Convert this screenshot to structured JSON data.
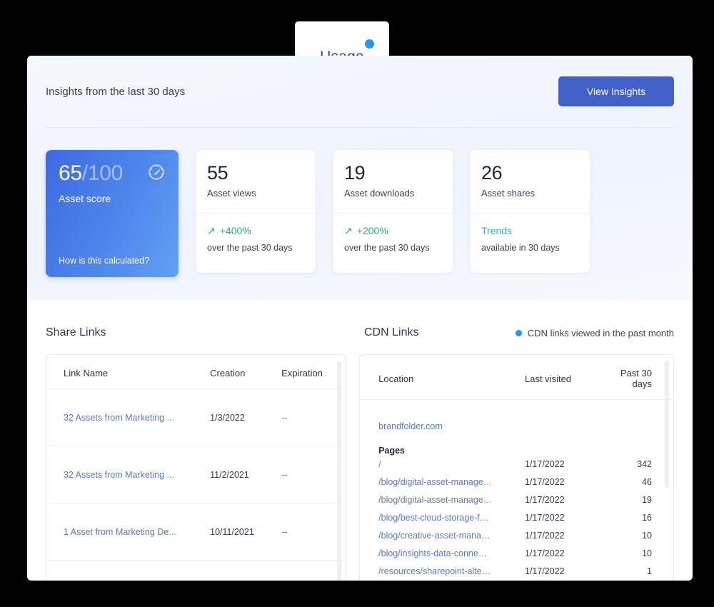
{
  "tab": {
    "label": "Usage",
    "dot_icon": "blue-dot-indicator",
    "dot_color": "#2196f3"
  },
  "header": {
    "title": "Insights from the last 30 days",
    "view_insights_label": "View Insights",
    "button_color": "#4160c8"
  },
  "score_card": {
    "value": "65",
    "denominator": "/100",
    "label": "Asset score",
    "footer_link": "How is this calculated?",
    "icon": "gauge-icon",
    "gradient_from": "#3f6ae0",
    "gradient_to": "#63a0f3"
  },
  "metrics": [
    {
      "number": "55",
      "label": "Asset views",
      "delta_icon": "arrow-up-right-icon",
      "delta": "+400%",
      "delta_color": "#22b07d",
      "sub": "over the past 30 days"
    },
    {
      "number": "19",
      "label": "Asset downloads",
      "delta_icon": "arrow-up-right-icon",
      "delta": "+200%",
      "delta_color": "#22b07d",
      "sub": "over the past 30 days"
    },
    {
      "number": "26",
      "label": "Asset shares",
      "delta_icon": "",
      "delta": "Trends",
      "delta_color": "#35aee0",
      "sub": "available in 30 days"
    }
  ],
  "share_links": {
    "title": "Share Links",
    "columns": [
      "Link Name",
      "Creation",
      "Expiration"
    ],
    "rows": [
      {
        "name": "32 Assets from Marketing ...",
        "creation": "1/3/2022",
        "expiration": "--"
      },
      {
        "name": "32 Assets from Marketing ...",
        "creation": "11/2/2021",
        "expiration": "--"
      },
      {
        "name": "1 Asset from Marketing De...",
        "creation": "10/11/2021",
        "expiration": "--"
      }
    ]
  },
  "cdn_links": {
    "title": "CDN Links",
    "legend": "CDN links viewed in the past month",
    "legend_dot_color": "#2196f3",
    "columns": [
      "Location",
      "Last visited",
      "Past 30 days"
    ],
    "domain": "brandfolder.com",
    "pages_label": "Pages",
    "rows": [
      {
        "path": "/",
        "last_visited": "1/17/2022",
        "past30": "342"
      },
      {
        "path": "/blog/digital-asset-manage…",
        "last_visited": "1/17/2022",
        "past30": "46"
      },
      {
        "path": "/blog/digital-asset-manage…",
        "last_visited": "1/17/2022",
        "past30": "19"
      },
      {
        "path": "/blog/best-cloud-storage-f…",
        "last_visited": "1/17/2022",
        "past30": "16"
      },
      {
        "path": "/blog/creative-asset-mana…",
        "last_visited": "1/17/2022",
        "past30": "10"
      },
      {
        "path": "/blog/insights-data-conne…",
        "last_visited": "1/17/2022",
        "past30": "10"
      },
      {
        "path": "/resources/sharepoint-alte…",
        "last_visited": "1/17/2022",
        "past30": "1"
      }
    ]
  }
}
